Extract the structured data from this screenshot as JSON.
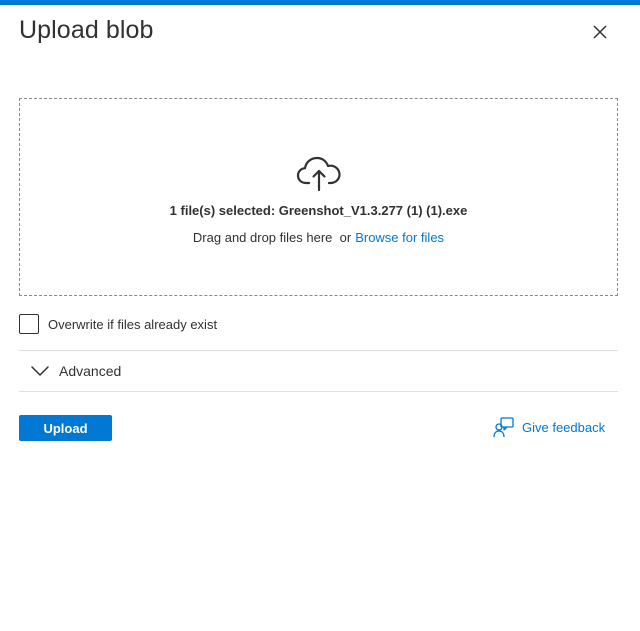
{
  "panel": {
    "title": "Upload blob",
    "close_icon": "close-icon"
  },
  "dropzone": {
    "icon": "cloud-upload-icon",
    "selected_text": "1 file(s) selected: Greenshot_V1.3.277 (1) (1).exe",
    "drag_text": "Drag and drop files here  or",
    "browse_label": "Browse for files"
  },
  "overwrite": {
    "label": "Overwrite if files already exist",
    "checked": false
  },
  "advanced": {
    "label": "Advanced",
    "icon": "chevron-down-icon",
    "expanded": false
  },
  "actions": {
    "upload_label": "Upload",
    "feedback_label": "Give feedback",
    "feedback_icon": "feedback-icon"
  },
  "colors": {
    "accent": "#0078d4",
    "text": "#323130",
    "divider": "#e1dfdd",
    "dropzone_border": "#8a8886"
  }
}
